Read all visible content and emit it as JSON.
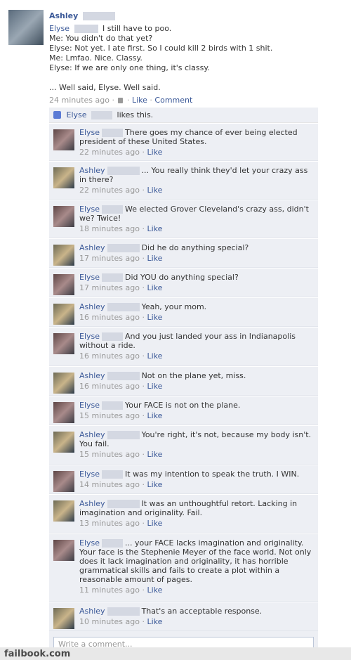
{
  "post": {
    "author": "Ashley",
    "lines": [
      {
        "speaker": "Elyse",
        "text": "I still have to poo."
      },
      {
        "speaker": null,
        "text": "Me: You didn't do that yet?"
      },
      {
        "speaker": null,
        "text": "Elyse: Not yet. I ate first. So I could kill 2 birds with 1 shit."
      },
      {
        "speaker": null,
        "text": "Me: Lmfao. Nice. Classy."
      },
      {
        "speaker": null,
        "text": "Elyse: If we are only one thing, it's classy."
      },
      {
        "speaker": null,
        "text": ""
      },
      {
        "speaker": null,
        "text": "... Well said, Elyse. Well said."
      }
    ],
    "time": "24 minutes ago",
    "like_label": "Like",
    "comment_label": "Comment"
  },
  "likes": {
    "name": "Elyse",
    "text": "likes this."
  },
  "comments": [
    {
      "author": "Elyse",
      "text": "There goes my chance of ever being elected president of these United States.",
      "time": "22 minutes ago",
      "like": "Like"
    },
    {
      "author": "Ashley",
      "text": "... You really think they'd let your crazy ass in there?",
      "time": "22 minutes ago",
      "like": "Like"
    },
    {
      "author": "Elyse",
      "text": "We elected Grover Cleveland's crazy ass, didn't we? Twice!",
      "time": "18 minutes ago",
      "like": "Like"
    },
    {
      "author": "Ashley",
      "text": "Did he do anything special?",
      "time": "17 minutes ago",
      "like": "Like"
    },
    {
      "author": "Elyse",
      "text": "Did YOU do anything special?",
      "time": "17 minutes ago",
      "like": "Like"
    },
    {
      "author": "Ashley",
      "text": "Yeah, your mom.",
      "time": "16 minutes ago",
      "like": "Like"
    },
    {
      "author": "Elyse",
      "text": "And you just landed your ass in Indianapolis without a ride.",
      "time": "16 minutes ago",
      "like": "Like"
    },
    {
      "author": "Ashley",
      "text": "Not on the plane yet, miss.",
      "time": "16 minutes ago",
      "like": "Like"
    },
    {
      "author": "Elyse",
      "text": "Your FACE is not on the plane.",
      "time": "15 minutes ago",
      "like": "Like"
    },
    {
      "author": "Ashley",
      "text": "You're right, it's not, because my body isn't. You fail.",
      "time": "15 minutes ago",
      "like": "Like"
    },
    {
      "author": "Elyse",
      "text": "It was my intention to speak the truth. I WIN.",
      "time": "14 minutes ago",
      "like": "Like"
    },
    {
      "author": "Ashley",
      "text": "It was an unthoughtful retort. Lacking in imagination and originality. Fail.",
      "time": "13 minutes ago",
      "like": "Like"
    },
    {
      "author": "Elyse",
      "text": "... your FACE lacks imagination and originality. Your face is the Stephenie Meyer of the face world. Not only does it lack imagination and originality, it has horrible grammatical skills and fails to create a plot within a reasonable amount of pages.",
      "time": "11 minutes ago",
      "like": "Like"
    },
    {
      "author": "Ashley",
      "text": "That's an acceptable response.",
      "time": "10 minutes ago",
      "like": "Like"
    }
  ],
  "write_placeholder": "Write a comment...",
  "footer": "failbook.com",
  "colors": {
    "link": "#3b5998",
    "ufi_bg": "#edeff4",
    "meta": "#999999"
  }
}
